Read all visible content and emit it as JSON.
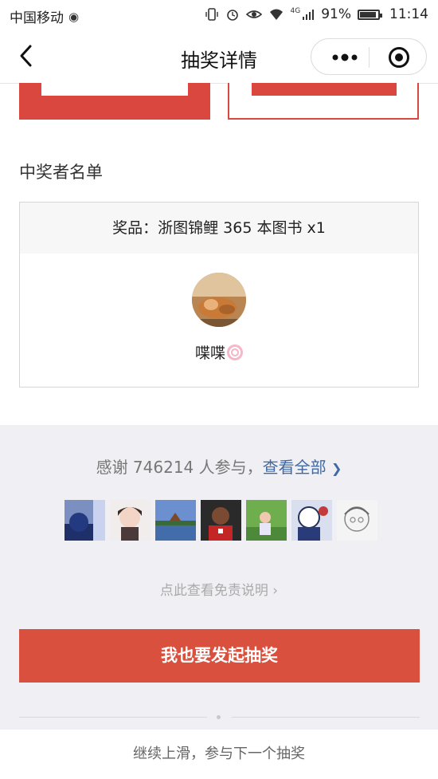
{
  "status_bar": {
    "carrier": "中国移动",
    "network": "4G",
    "battery": "91%",
    "battery_level": 0.91,
    "time": "11:14",
    "icons": [
      "vibrate-icon",
      "alarm-icon",
      "eye-icon",
      "wifi-icon",
      "signal-icon",
      "battery-icon"
    ]
  },
  "nav": {
    "title": "抽奖详情",
    "back_icon": "chevron-left-icon",
    "more_icon": "more-dots-icon",
    "close_icon": "target-circle-icon"
  },
  "winners": {
    "section_title": "中奖者名单",
    "prize_text": "奖品：浙图锦鲤 365 本图书 x1",
    "winner_name": "喋喋"
  },
  "participation": {
    "thanks_text": "感谢 746214 人参与，",
    "view_all": "查看全部",
    "view_all_chevron": "❯",
    "disclaimer": "点此查看免责说明 ›"
  },
  "cta": {
    "label": "我也要发起抽奖"
  },
  "footer": {
    "hint": "继续上滑，参与下一个抽奖"
  },
  "colors": {
    "brand_red": "#d9503f",
    "link_blue": "#3f6aa5",
    "grey_bg": "#efeff4"
  }
}
